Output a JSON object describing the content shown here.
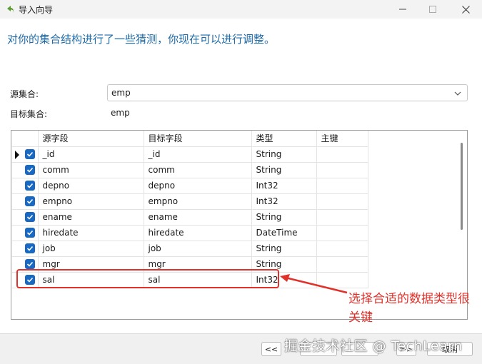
{
  "window": {
    "title": "导入向导",
    "icon": "back-arrow-icon",
    "controls": [
      "minimize-icon",
      "maximize-icon",
      "close-icon"
    ]
  },
  "heading": "对你的集合结构进行了一些猜测，你现在可以进行调整。",
  "source_label": "源集合:",
  "source_value": "emp",
  "target_label": "目标集合:",
  "target_value": "emp",
  "grid": {
    "columns": [
      "源字段",
      "目标字段",
      "类型",
      "主键"
    ],
    "rows": [
      {
        "checked": true,
        "source": "_id",
        "target": "_id",
        "type": "String",
        "key": ""
      },
      {
        "checked": true,
        "source": "comm",
        "target": "comm",
        "type": "String",
        "key": ""
      },
      {
        "checked": true,
        "source": "depno",
        "target": "depno",
        "type": "Int32",
        "key": ""
      },
      {
        "checked": true,
        "source": "empno",
        "target": "empno",
        "type": "Int32",
        "key": ""
      },
      {
        "checked": true,
        "source": "ename",
        "target": "ename",
        "type": "String",
        "key": ""
      },
      {
        "checked": true,
        "source": "hiredate",
        "target": "hiredate",
        "type": "DateTime",
        "key": ""
      },
      {
        "checked": true,
        "source": "job",
        "target": "job",
        "type": "String",
        "key": ""
      },
      {
        "checked": true,
        "source": "mgr",
        "target": "mgr",
        "type": "String",
        "key": ""
      },
      {
        "checked": true,
        "source": "sal",
        "target": "sal",
        "type": "Int32",
        "key": ""
      }
    ]
  },
  "annotation": "选择合适的数据类型很关键",
  "footer": {
    "prev_all": "<<",
    "prev": "",
    "next": "",
    "next_all": ">>",
    "cancel": "取消"
  },
  "watermark": "掘金技术社区 @ TechLearn",
  "colors": {
    "heading": "#1e6aa8",
    "checkbox": "#1769c4",
    "annotation": "#e0322b"
  }
}
